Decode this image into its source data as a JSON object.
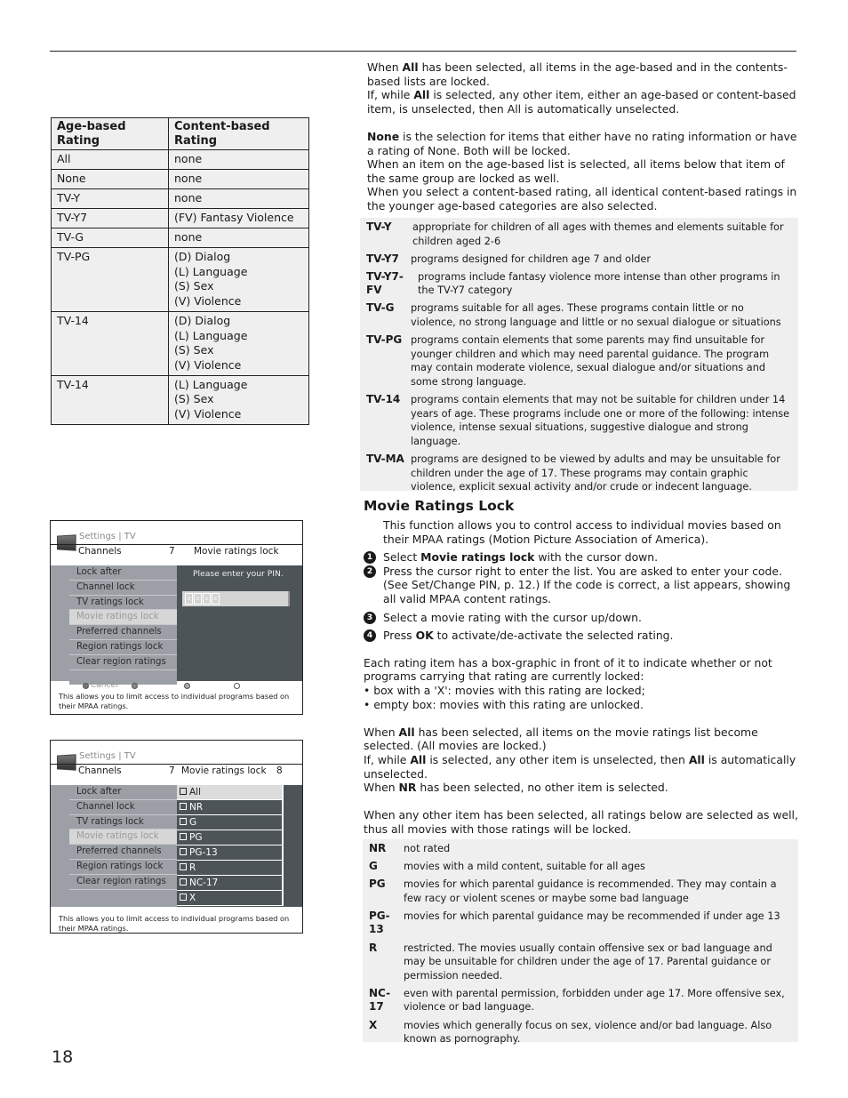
{
  "page_number": "18",
  "ratings_table": {
    "headers": [
      "Age-based Rating",
      "Content-based Rating"
    ],
    "rows": [
      {
        "age": "All",
        "content": [
          "none"
        ]
      },
      {
        "age": "None",
        "content": [
          "none"
        ]
      },
      {
        "age": "TV-Y",
        "content": [
          "none"
        ]
      },
      {
        "age": "TV-Y7",
        "content": [
          "(FV) Fantasy Violence"
        ]
      },
      {
        "age": "TV-G",
        "content": [
          "none"
        ]
      },
      {
        "age": "TV-PG",
        "content": [
          "(D) Dialog",
          "(L) Language",
          "(S) Sex",
          "(V) Violence"
        ]
      },
      {
        "age": "TV-14",
        "content": [
          "(D) Dialog",
          "(L) Language",
          "(S) Sex",
          "(V) Violence"
        ]
      },
      {
        "age": "TV-14",
        "content": [
          "(L) Language",
          "(S) Sex",
          "(V) Violence"
        ]
      }
    ]
  },
  "tv_menu_1": {
    "breadcrumb": "Settings | TV",
    "sub_left": "Channels",
    "sub_num": "7",
    "sub_right": "Movie ratings lock",
    "menu_items": [
      "Lock after",
      "Channel lock",
      "TV ratings lock",
      "Movie ratings lock",
      "Preferred channels",
      "Region ratings lock",
      "Clear region ratings",
      ""
    ],
    "active_index": 3,
    "pin_prompt": "Please enter your PIN.",
    "pin_cells": [
      "x",
      "x",
      "x",
      "x"
    ],
    "cancel_label": "Cancel",
    "footer": "This allows you to limit access to individual programs based on their MPAA ratings."
  },
  "tv_menu_2": {
    "breadcrumb": "Settings | TV",
    "sub_left": "Channels",
    "sub_num": "7",
    "sub_right": "Movie ratings lock",
    "sub_num_right": "8",
    "menu_items": [
      "Lock after",
      "Channel lock",
      "TV ratings lock",
      "Movie ratings lock",
      "Preferred channels",
      "Region ratings lock",
      "Clear region ratings",
      ""
    ],
    "active_index": 3,
    "ratings_list": [
      "All",
      "NR",
      "G",
      "PG",
      "PG-13",
      "R",
      "NC-17",
      "X"
    ],
    "ratings_active_index": 0,
    "footer": "This allows you to limit access to individual programs based on their MPAA ratings."
  },
  "intro": {
    "p1a": "When ",
    "p1b": "All",
    "p1c": " has been selected, all items in the age-based and in the contents-based lists are locked.",
    "p2a": "If, while ",
    "p2b": "All",
    "p2c": " is selected, any other item, either an age-based or content-based item, is unselected, then All is automatically unselected.",
    "p3a": "None",
    "p3b": " is the selection for items that either have no rating information or have a rating of None. Both will be locked.",
    "p4": "When an item on the age-based list is selected, all items below that item of the same group are locked as well.",
    "p5": "When you select a content-based rating, all identical content-based ratings in the younger age-based categories are also selected."
  },
  "tv_definitions": [
    {
      "term": "TV-Y",
      "desc": "appropriate for children of all ages with themes and elements suitable for children aged 2-6"
    },
    {
      "term": "TV-Y7",
      "desc": "programs designed for children age 7 and older"
    },
    {
      "term": "TV-Y7-FV",
      "desc": "programs include fantasy violence more intense than other programs in the TV-Y7 category"
    },
    {
      "term": "TV-G",
      "desc": "programs suitable for all ages. These programs contain little or no violence, no strong language and little or no sexual dialogue or situations"
    },
    {
      "term": "TV-PG",
      "desc": "programs contain elements that some parents may find unsuitable for younger children and which may need parental guidance. The program may contain moderate violence, sexual dialogue and/or situations and some strong language."
    },
    {
      "term": "TV-14",
      "desc": "programs contain elements that may not be suitable for children under 14 years of age. These programs include one or more of the following: intense violence, intense sexual situations, suggestive dialogue and strong language."
    },
    {
      "term": "TV-MA",
      "desc": "programs are designed to be viewed by adults and may be unsuitable for children under the age of 17. These programs may contain graphic violence, explicit sexual activity and/or crude or indecent language."
    }
  ],
  "movie_section": {
    "title": "Movie Ratings Lock",
    "intro": "This function allows you to control access to individual movies based on their MPAA ratings (Motion Picture Association of America).",
    "steps": [
      {
        "num": "1",
        "a": "Select ",
        "b": "Movie ratings lock",
        "c": " with the cursor down."
      },
      {
        "num": "2",
        "a": "Press the cursor right to enter the list. You are asked to enter your code. (See Set/Change PIN, p. 12.) If the code is correct, a list appears, showing all valid MPAA content ratings.",
        "b": "",
        "c": ""
      },
      {
        "num": "3",
        "a": "Select a movie rating with the cursor up/down.",
        "b": "",
        "c": ""
      },
      {
        "num": "4",
        "a": "Press ",
        "b": "OK",
        "c": " to activate/de-activate the selected rating."
      }
    ],
    "box_p1": "Each rating item has a box-graphic in front of it to indicate whether or not programs carrying that rating are currently locked:",
    "box_b1": "• box with a 'X': movies with this rating are locked;",
    "box_b2": "• empty box: movies with this rating are unlocked.",
    "all_p1a": "When ",
    "all_p1b": "All",
    "all_p1c": " has been selected, all items on the movie ratings list become selected. (All movies are locked.)",
    "all_p2a": "If, while ",
    "all_p2b": "All",
    "all_p2c": " is selected, any other item is unselected, then ",
    "all_p2d": "All",
    "all_p2e": " is automatically unselected.",
    "all_p3a": "When ",
    "all_p3b": "NR",
    "all_p3c": " has been selected, no other item is selected.",
    "other_p": "When any other item has been selected, all ratings below are selected as well, thus all movies with those ratings will be locked."
  },
  "movie_definitions": [
    {
      "term": "NR",
      "desc": "not rated"
    },
    {
      "term": "G",
      "desc": "movies with a mild content, suitable for all ages"
    },
    {
      "term": "PG",
      "desc": "movies for which parental guidance is recommended. They may contain a few racy or violent scenes or maybe some bad language"
    },
    {
      "term": "PG-13",
      "desc": "movies for which parental guidance may be recommended if under age 13"
    },
    {
      "term": "R",
      "desc": "restricted. The movies usually contain offensive sex or bad language and may be unsuitable for children under the age of 17. Parental guidance or permission needed."
    },
    {
      "term": "NC-17",
      "desc": "even with parental permission, forbidden under age 17. More offensive sex, violence or bad language."
    },
    {
      "term": "X",
      "desc": "movies which generally focus on sex, violence and/or bad language. Also known as pornography."
    }
  ]
}
